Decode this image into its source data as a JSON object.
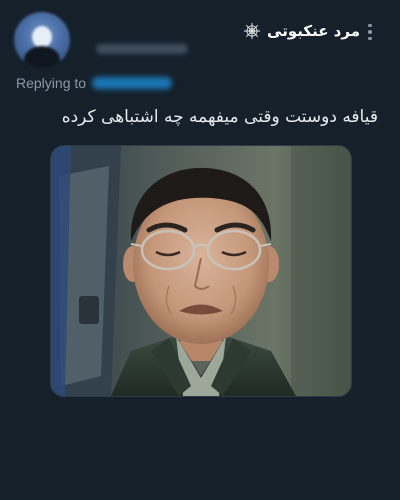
{
  "author": {
    "display_name": "مرد عنکبوتی",
    "badge_icon": "spider-web-icon",
    "avatar": "avatar-blurred"
  },
  "reply": {
    "label": "Replying to"
  },
  "tweet": {
    "text": "قیافه دوستت وقتی میفهمه چه اشتباهی کرده",
    "media": "meme-image-crying-man-with-glasses"
  },
  "colors": {
    "background": "#15202b",
    "text": "#e7e9ea",
    "secondary": "#8b98a5",
    "accent": "#1d9bf0"
  }
}
